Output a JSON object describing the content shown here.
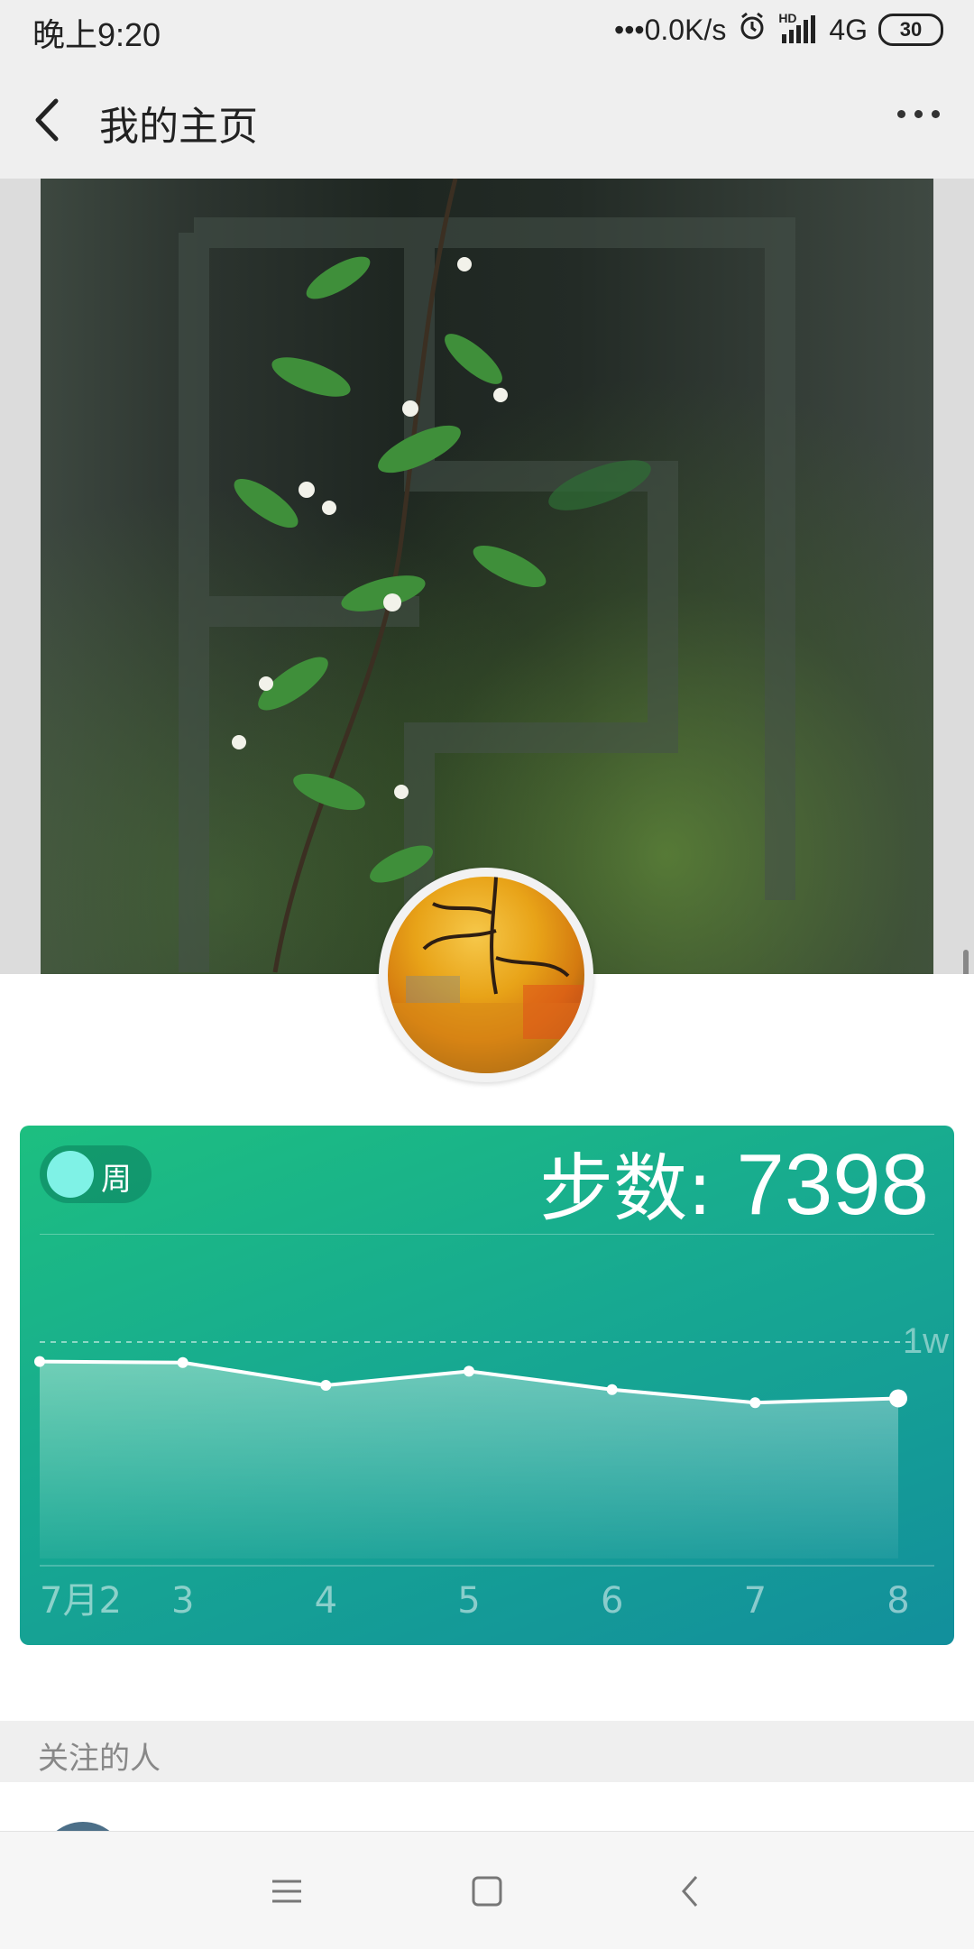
{
  "status_bar": {
    "time": "晚上9:20",
    "network_speed": "•••0.0K/s",
    "network_type": "4G",
    "hd_label": "HD",
    "battery": "30",
    "icons": [
      "alarm-icon",
      "signal-icon",
      "battery-icon"
    ]
  },
  "nav": {
    "back_icon": "chevron-left-icon",
    "title": "我的主页",
    "more_icon": "more-horizontal-icon"
  },
  "steps_card": {
    "toggle_label": "周",
    "steps_label": "步数",
    "steps_separator": ":",
    "steps_value": "7398",
    "colors": {
      "gradient_start": "#1dbf80",
      "gradient_end": "#128f9c",
      "knob": "#7ff2e6"
    }
  },
  "chart_data": {
    "type": "area",
    "categories": [
      "7月2",
      "3",
      "4",
      "5",
      "6",
      "7",
      "8"
    ],
    "values": [
      9100,
      9050,
      8000,
      8650,
      7800,
      7200,
      7398
    ],
    "reference_line": {
      "label": "1w",
      "value": 10000
    },
    "ylim": [
      0,
      15000
    ],
    "grid": false,
    "highlight_last": true
  },
  "following": {
    "title": "关注的人"
  },
  "system_nav": {
    "menu_icon": "menu-icon",
    "home_icon": "home-square-icon",
    "back_icon": "back-triangle-icon"
  }
}
